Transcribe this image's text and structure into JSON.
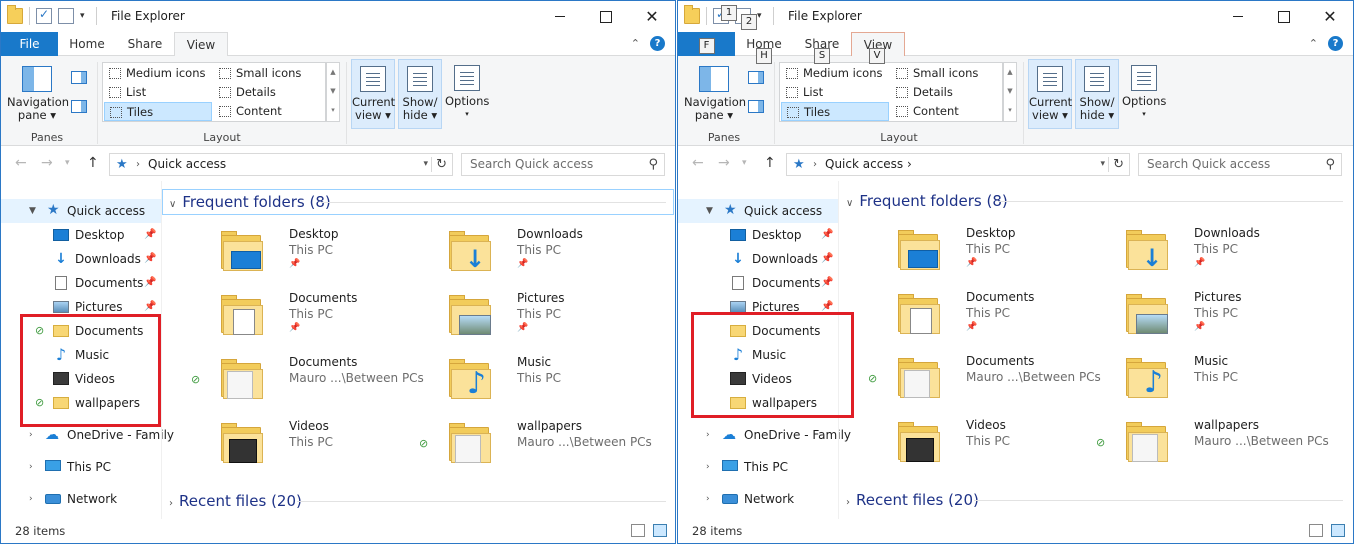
{
  "left": {
    "title": "File Explorer",
    "tabs": {
      "file": "File",
      "home": "Home",
      "share": "Share",
      "view": "View"
    },
    "ribbon": {
      "navigation_pane": "Navigation",
      "navigation_pane_2": "pane",
      "panes": "Panes",
      "medium_icons": "Medium icons",
      "small_icons": "Small icons",
      "list": "List",
      "details": "Details",
      "tiles": "Tiles",
      "content": "Content",
      "layout": "Layout",
      "current_view": "Current",
      "current_view_2": "view",
      "show_hide": "Show/",
      "show_hide_2": "hide",
      "options": "Options"
    },
    "address": {
      "crumb": "Quick access",
      "search_placeholder": "Search Quick access"
    },
    "tree": {
      "quick_access": "Quick access",
      "desktop": "Desktop",
      "downloads": "Downloads",
      "documents": "Documents",
      "pictures": "Pictures",
      "documents2": "Documents",
      "music": "Music",
      "videos": "Videos",
      "wallpapers": "wallpapers",
      "onedrive": "OneDrive - Family",
      "this_pc": "This PC",
      "network": "Network"
    },
    "frequent": {
      "label": "Frequent folders",
      "count": "(8)"
    },
    "recent": {
      "label": "Recent files",
      "count": "(20)"
    },
    "tiles": [
      {
        "name": "Desktop",
        "loc": "This PC"
      },
      {
        "name": "Downloads",
        "loc": "This PC"
      },
      {
        "name": "Documents",
        "loc": "This PC"
      },
      {
        "name": "Pictures",
        "loc": "This PC"
      },
      {
        "name": "Documents",
        "loc": "Mauro ...\\Between PCs"
      },
      {
        "name": "Music",
        "loc": "This PC"
      },
      {
        "name": "Videos",
        "loc": "This PC"
      },
      {
        "name": "wallpapers",
        "loc": "Mauro ...\\Between PCs"
      }
    ],
    "status": "28 items"
  },
  "right": {
    "title": "File Explorer",
    "tabs": {
      "file": "F",
      "home": "Home",
      "share": "Share",
      "view": "View"
    },
    "keytips": {
      "qat1": "1",
      "qat2": "2",
      "home": "H",
      "share": "S",
      "view": "V"
    },
    "ribbon": {
      "navigation_pane": "Navigation",
      "navigation_pane_2": "pane",
      "panes": "Panes",
      "medium_icons": "Medium icons",
      "small_icons": "Small icons",
      "list": "List",
      "details": "Details",
      "tiles": "Tiles",
      "content": "Content",
      "layout": "Layout",
      "current_view": "Current",
      "current_view_2": "view",
      "show_hide": "Show/",
      "show_hide_2": "hide",
      "options": "Options"
    },
    "address": {
      "crumb": "Quick access",
      "search_placeholder": "Search Quick access"
    },
    "tree": {
      "quick_access": "Quick access",
      "desktop": "Desktop",
      "downloads": "Downloads",
      "documents": "Documents",
      "pictures": "Pictures",
      "documents2": "Documents",
      "music": "Music",
      "videos": "Videos",
      "wallpapers": "wallpapers",
      "onedrive": "OneDrive - Family",
      "this_pc": "This PC",
      "network": "Network"
    },
    "frequent": {
      "label": "Frequent folders",
      "count": "(8)"
    },
    "recent": {
      "label": "Recent files",
      "count": "(20)"
    },
    "tiles": [
      {
        "name": "Desktop",
        "loc": "This PC"
      },
      {
        "name": "Downloads",
        "loc": "This PC"
      },
      {
        "name": "Documents",
        "loc": "This PC"
      },
      {
        "name": "Pictures",
        "loc": "This PC"
      },
      {
        "name": "Documents",
        "loc": "Mauro ...\\Between PCs"
      },
      {
        "name": "Music",
        "loc": "This PC"
      },
      {
        "name": "Videos",
        "loc": "This PC"
      },
      {
        "name": "wallpapers",
        "loc": "Mauro ...\\Between PCs"
      }
    ],
    "status": "28 items"
  },
  "colors": {
    "accent": "#1979ca",
    "highlight": "#e01e26",
    "sync": "#3d9a3d"
  }
}
